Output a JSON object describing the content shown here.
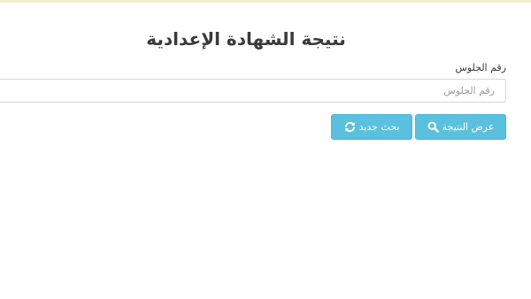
{
  "page": {
    "title": "نتيجة الشهادة الإعدادية"
  },
  "form": {
    "seat_number_label": "رقم الجلوس",
    "seat_number_placeholder": "رقم الجلوس",
    "seat_number_value": ""
  },
  "buttons": {
    "show_result": {
      "label": "عرض النتيجة",
      "icon": "search-icon"
    },
    "new_search": {
      "label": "بحث جديد",
      "icon": "refresh-icon"
    }
  },
  "colors": {
    "button_bg": "#5bc0de",
    "button_border": "#46b8da",
    "top_strip": "#f5eec8"
  }
}
